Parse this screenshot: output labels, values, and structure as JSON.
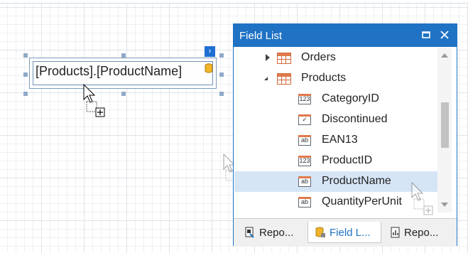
{
  "designer": {
    "label_expression": "[Products].[ProductName]",
    "smart_tag_glyph": "›"
  },
  "field_list": {
    "title": "Field List",
    "tree": [
      {
        "label": "Orders",
        "kind": "table",
        "expanded": false
      },
      {
        "label": "Products",
        "kind": "table",
        "expanded": true
      },
      {
        "label": "CategoryID",
        "kind": "field",
        "type": "number",
        "icon_text": "123"
      },
      {
        "label": "Discontinued",
        "kind": "field",
        "type": "boolean",
        "icon_text": "✓"
      },
      {
        "label": "EAN13",
        "kind": "field",
        "type": "string",
        "icon_text": "ab"
      },
      {
        "label": "ProductID",
        "kind": "field",
        "type": "number",
        "icon_text": "123"
      },
      {
        "label": "ProductName",
        "kind": "field",
        "type": "string",
        "icon_text": "ab",
        "selected": true
      },
      {
        "label": "QuantityPerUnit",
        "kind": "field",
        "type": "string",
        "icon_text": "ab"
      }
    ],
    "tabs": [
      {
        "label": "Repo...",
        "icon": "report-explorer-icon",
        "active": false
      },
      {
        "label": "Field L...",
        "icon": "database-icon",
        "active": true
      },
      {
        "label": "Repo...",
        "icon": "report-gallery-icon",
        "active": false
      }
    ]
  },
  "colors": {
    "accent": "#1f72c4",
    "selection": "#d6e5f6",
    "field_icon_bar": "#e07a4a"
  }
}
